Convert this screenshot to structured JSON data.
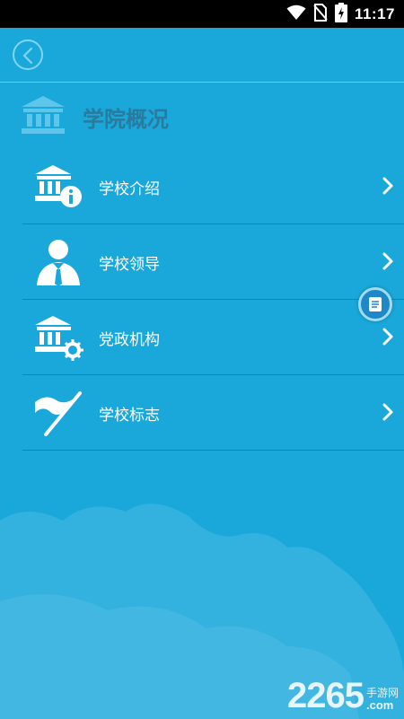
{
  "status_bar": {
    "time": "11:17",
    "icons": [
      "wifi-icon",
      "no-sim-icon",
      "battery-charging-icon"
    ]
  },
  "header": {
    "back_icon": "chevron-left-icon"
  },
  "section": {
    "title": "学院概况",
    "icon": "institution-icon"
  },
  "menu": {
    "items": [
      {
        "label": "学校介绍",
        "icon": "building-info-icon"
      },
      {
        "label": "学校领导",
        "icon": "person-suit-icon"
      },
      {
        "label": "党政机构",
        "icon": "building-gear-icon"
      },
      {
        "label": "学校标志",
        "icon": "flag-icon"
      }
    ]
  },
  "floating_button": {
    "icon": "document-icon"
  },
  "watermark": {
    "number": "2265",
    "site_cn": "手游网",
    "domain": ".com"
  },
  "colors": {
    "background": "#1aa7d9",
    "status_bar": "#000000",
    "divider": "#1583aa",
    "section_title": "#2a7a9e"
  }
}
